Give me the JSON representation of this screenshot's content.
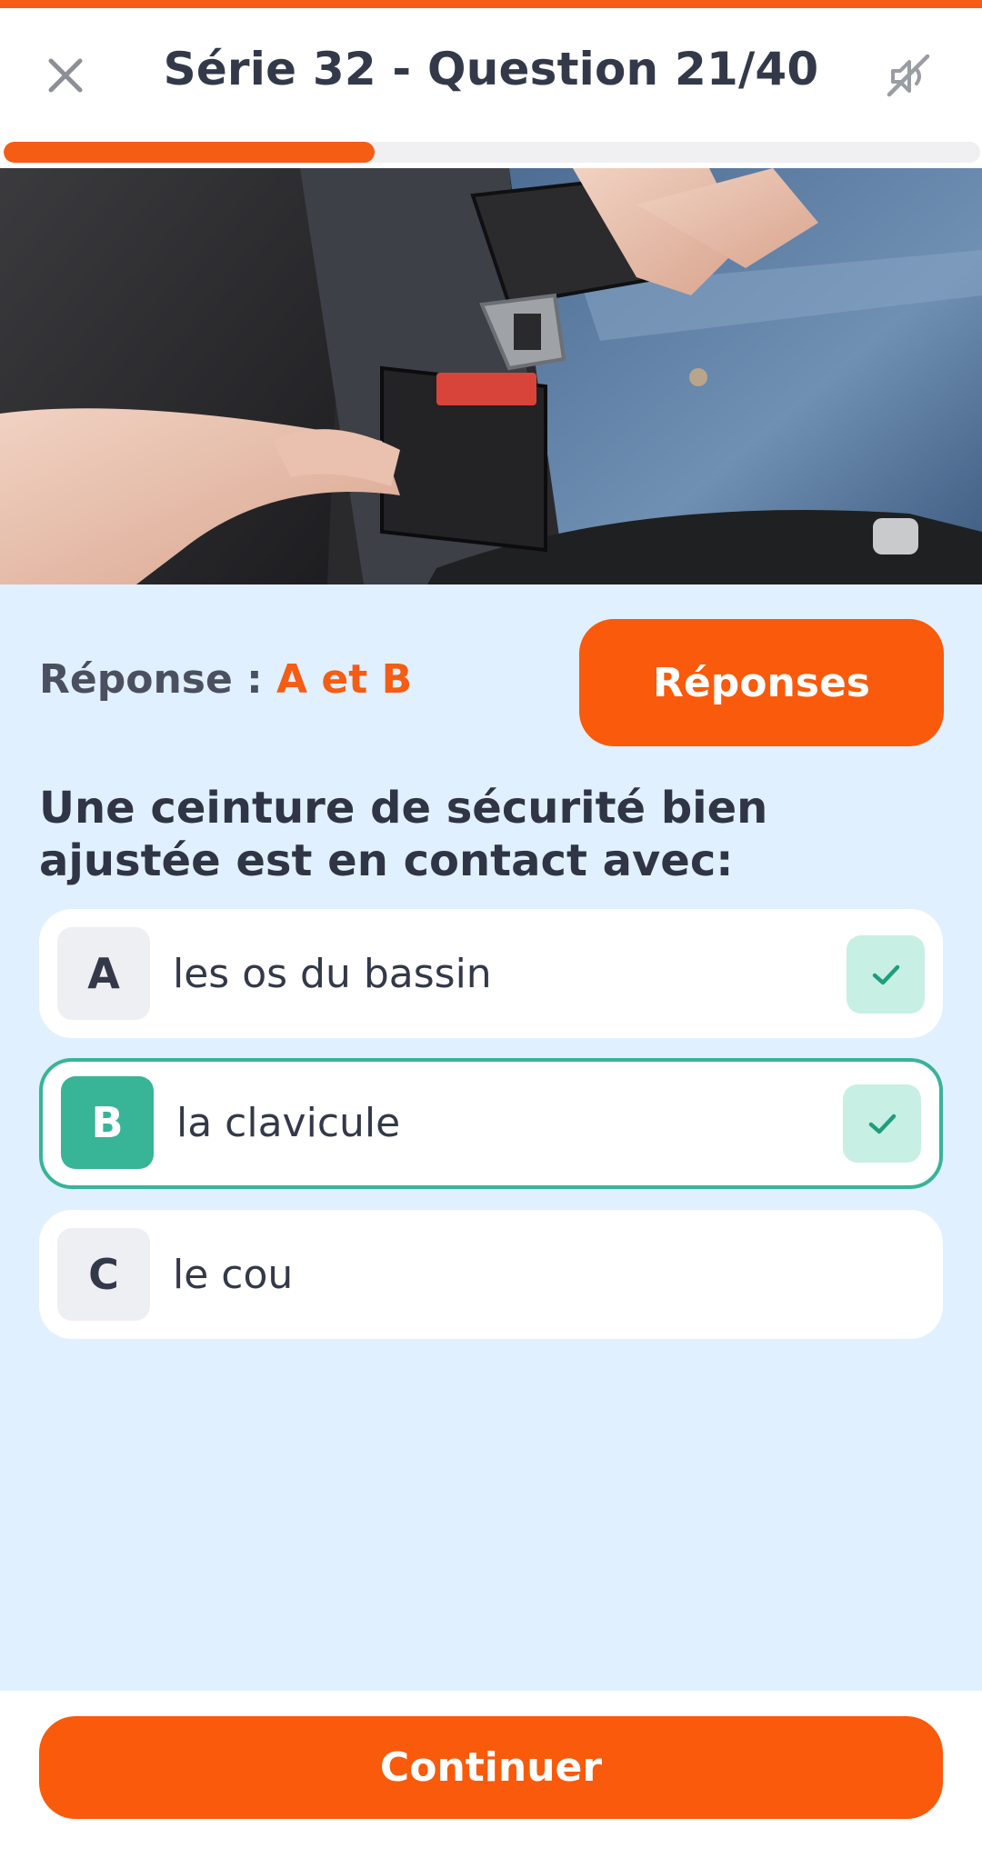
{
  "header": {
    "title": "Série 32 - Question 21/40",
    "close_icon": "close-icon",
    "sound_icon": "sound-off-icon"
  },
  "progress": {
    "fraction": 0.38
  },
  "image": {
    "description_icon": "seatbelt-photo"
  },
  "answer": {
    "label": "Réponse :",
    "value": "A et B",
    "button_label": "Réponses"
  },
  "question": {
    "text": "Une ceinture de sécurité bien ajustée est en contact avec:"
  },
  "options": [
    {
      "letter": "A",
      "text": "les os du bassin",
      "checked": true,
      "selected": false
    },
    {
      "letter": "B",
      "text": "la clavicule",
      "checked": true,
      "selected": true
    },
    {
      "letter": "C",
      "text": "le cou",
      "checked": false,
      "selected": false
    }
  ],
  "footer": {
    "continue_label": "Continuer"
  },
  "colors": {
    "accent": "#f95a0b",
    "correct": "#38b497",
    "background": "#e1f0ff"
  }
}
